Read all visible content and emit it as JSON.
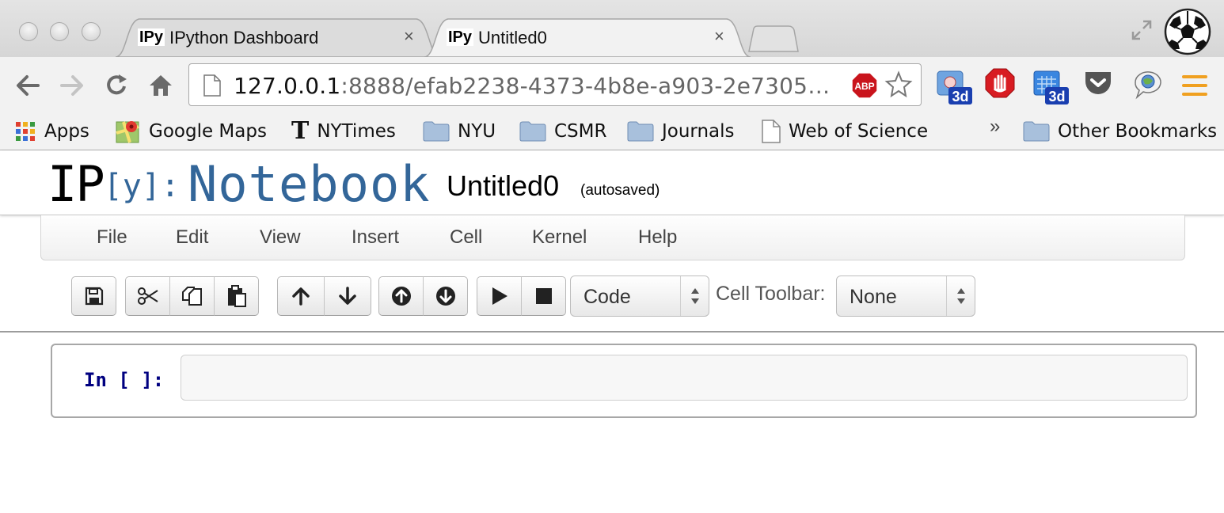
{
  "browser": {
    "tabs": [
      {
        "icon_text": "IPy",
        "title": "IPython Dashboard",
        "active": false
      },
      {
        "icon_text": "IPy",
        "title": "Untitled0",
        "active": true
      }
    ],
    "close_glyph": "×",
    "url_host": "127.0.0.1",
    "url_rest": ":8888/efab2238-4373-4b8e-a903-2e7305…",
    "abp_label": "ABP",
    "ext_badge": "3d",
    "bookmarks": [
      {
        "icon": "apps-grid-icon",
        "label": "Apps"
      },
      {
        "icon": "google-maps-icon",
        "label": "Google Maps"
      },
      {
        "icon": "nytimes-icon",
        "label": "NYTimes"
      },
      {
        "icon": "folder-icon",
        "label": "NYU"
      },
      {
        "icon": "folder-icon",
        "label": "CSMR"
      },
      {
        "icon": "folder-icon",
        "label": "Journals"
      },
      {
        "icon": "page-icon",
        "label": "Web of Science"
      },
      {
        "icon": "folder-icon",
        "label": "Other Bookmarks"
      }
    ],
    "bookmarks_overflow": "»",
    "nytimes_glyph": "T"
  },
  "notebook": {
    "logo_ip": "IP",
    "logo_y": "[y]:",
    "logo_word": "Notebook",
    "name": "Untitled0",
    "autosave_status": "(autosaved)",
    "menu": [
      "File",
      "Edit",
      "View",
      "Insert",
      "Cell",
      "Kernel",
      "Help"
    ],
    "cell_type": "Code",
    "cell_toolbar_label": "Cell Toolbar:",
    "cell_toolbar_value": "None",
    "cells": [
      {
        "prompt": "In [ ]:",
        "source": ""
      }
    ]
  },
  "colors": {
    "accent": "#336699",
    "prompt": "#000080"
  }
}
